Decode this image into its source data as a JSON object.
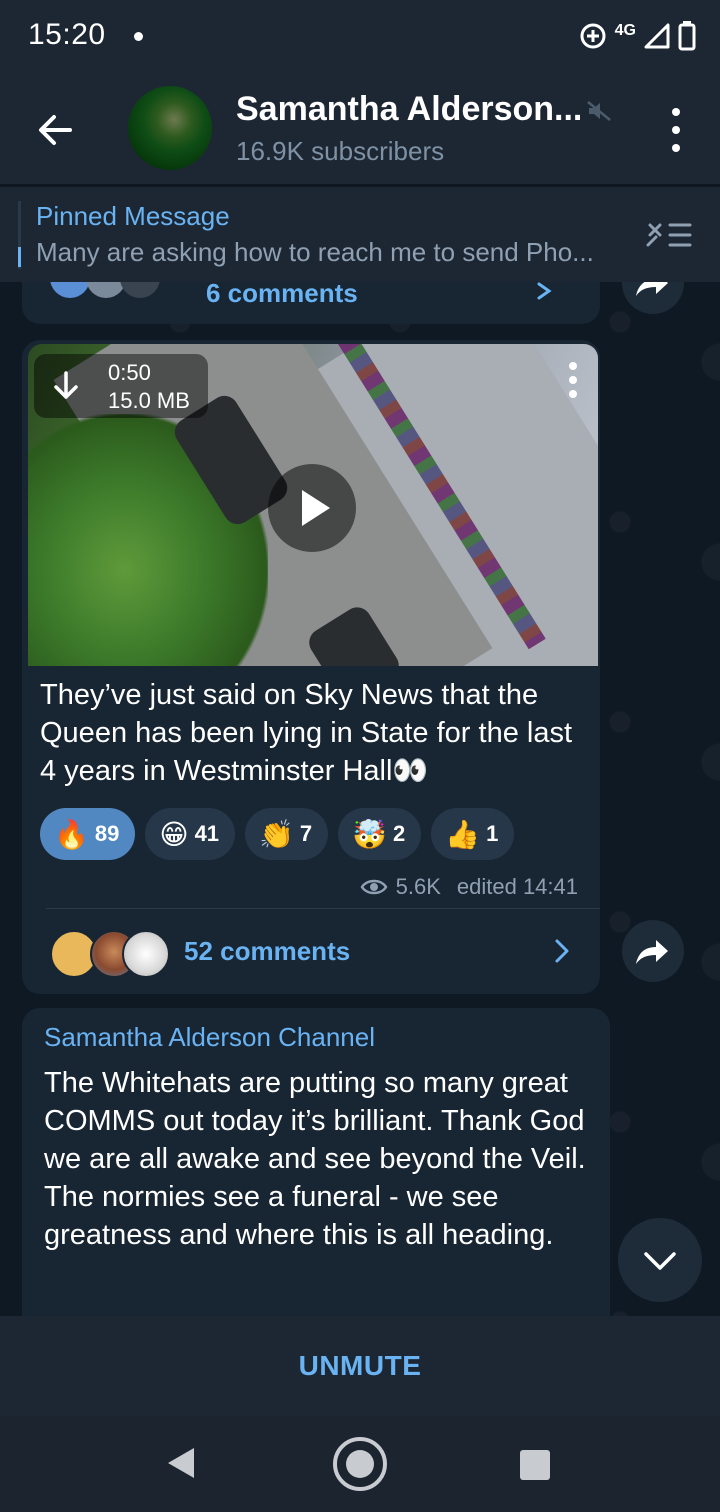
{
  "status_bar": {
    "time": "15:20",
    "network": "4G"
  },
  "header": {
    "title": "Samantha Alderson...",
    "subscribers": "16.9K subscribers"
  },
  "pinned": {
    "title": "Pinned Message",
    "text": "Many are asking how to reach me to send Pho..."
  },
  "previous_message": {
    "comments": "6 comments"
  },
  "video_message": {
    "duration": "0:50",
    "size": "15.0 MB",
    "text": "They’ve just said on Sky News that the Queen has been lying in State for the last 4 years in Westminster Hall👀",
    "reactions": [
      {
        "emoji": "🔥",
        "count": "89",
        "active": true
      },
      {
        "emoji": "😁",
        "count": "41",
        "active": false
      },
      {
        "emoji": "👏",
        "count": "7",
        "active": false
      },
      {
        "emoji": "🤯",
        "count": "2",
        "active": false
      },
      {
        "emoji": "👍",
        "count": "1",
        "active": false
      }
    ],
    "views": "5.6K",
    "edited": "edited 14:41",
    "comments": "52 comments"
  },
  "forwarded_message": {
    "from": "Samantha Alderson Channel",
    "text": "The Whitehats are putting so many great COMMS out today it’s brilliant. Thank God we are all awake and see beyond the Veil. The normies see a funeral - we see greatness and where this is all heading."
  },
  "bottom": {
    "unmute_label": "UNMUTE"
  },
  "colors": {
    "accent": "#6ab3f3",
    "bubble": "#182533",
    "bar": "#1d2733",
    "active_reaction": "#5288c1"
  }
}
